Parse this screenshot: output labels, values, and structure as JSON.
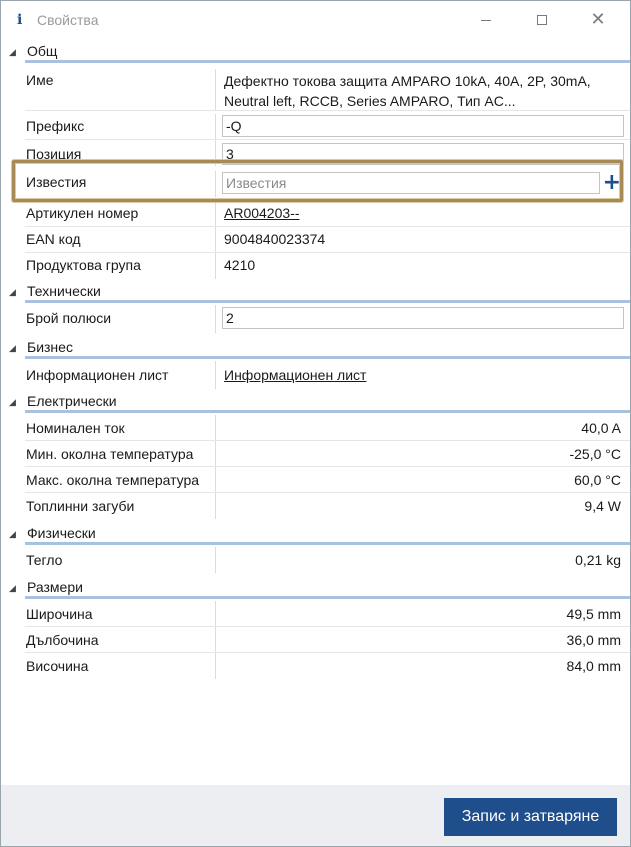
{
  "window": {
    "title": "Свойства",
    "title_icon": "i"
  },
  "sections": {
    "general": {
      "title": "Общ",
      "name_label": "Име",
      "name_value": "Дефектно токова защита AMPARO 10kA, 40A, 2P, 30mA, Neutral left, RCCB, Series AMPARO, Тип AC...",
      "prefix_label": "Префикс",
      "prefix_value": "-Q",
      "position_label": "Позиция",
      "position_value": "3",
      "notices_label": "Известия",
      "notices_placeholder": "Известия",
      "article_label": "Артикулен номер",
      "article_value": "AR004203--",
      "ean_label": "EAN код",
      "ean_value": "9004840023374",
      "group_label": "Продуктова група",
      "group_value": "4210"
    },
    "technical": {
      "title": "Технически",
      "poles_label": "Брой полюси",
      "poles_value": "2"
    },
    "business": {
      "title": "Бизнес",
      "sheet_label": "Информационен лист",
      "sheet_value": "Информационен лист"
    },
    "electrical": {
      "title": "Електрически",
      "current_label": "Номинален ток",
      "current_value": "40,0 A",
      "min_temp_label": "Мин. околна температура",
      "min_temp_value": "-25,0 °C",
      "max_temp_label": "Макс. околна температура",
      "max_temp_value": "60,0 °C",
      "heat_loss_label": "Топлинни загуби",
      "heat_loss_value": "9,4 W"
    },
    "physical": {
      "title": "Физически",
      "weight_label": "Тегло",
      "weight_value": "0,21 kg"
    },
    "dimensions": {
      "title": "Размери",
      "width_label": "Широчина",
      "width_value": "49,5 mm",
      "depth_label": "Дълбочина",
      "depth_value": "36,0 mm",
      "height_label": "Височина",
      "height_value": "84,0 mm"
    }
  },
  "footer": {
    "save_label": "Запис и затваряне"
  },
  "icons": {
    "collapse": "collapse-triangle-icon",
    "add": "plus-icon",
    "info": "info-icon"
  },
  "colors": {
    "accent": "#1f4e8c",
    "section_underline": "#a8c2de",
    "highlight": "#a88a55",
    "link": "#1f5fa8"
  }
}
